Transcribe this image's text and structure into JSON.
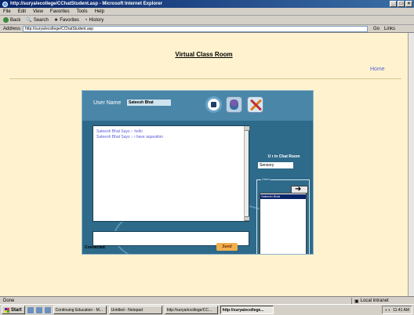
{
  "window": {
    "title": "http://surya/ecollege/CChatStudent.asp - Microsoft Internet Explorer",
    "controls": [
      "_",
      "□",
      "×"
    ]
  },
  "menu": [
    "File",
    "Edit",
    "View",
    "Favorites",
    "Tools",
    "Help"
  ],
  "toolbar": {
    "back": "Back",
    "search": "Search",
    "favorites": "Favorites",
    "history": "History"
  },
  "address": {
    "label": "Address",
    "url": "http://surya/ecollege/CChatStudent.asp",
    "go": "Go",
    "links": "Links"
  },
  "page": {
    "title": "Virtual Class Room",
    "home_link": "Home"
  },
  "chat": {
    "user_label": "User Name",
    "user_name": "Sateesh Bhat",
    "messages": [
      "Sateesh Bhat Says :- hello",
      "Sateesh Bhat Says :- i have aqueation"
    ],
    "room_title": "U r in Chat Room",
    "room_name": "Sensory",
    "users_label": "Users",
    "users": [
      "Sateesh Bhat"
    ],
    "status": "Connected",
    "send_label": "Send"
  },
  "status_bar": {
    "left": "Done",
    "zone": "Local intranet"
  },
  "taskbar": {
    "start": "Start",
    "tasks": [
      {
        "label": "Continuing Education - M...",
        "active": false
      },
      {
        "label": "Untitled - Notepad",
        "active": false
      },
      {
        "label": "http://surya/ecollege/CC...",
        "active": false
      },
      {
        "label": "http://surya/ecollege...",
        "active": true
      }
    ],
    "clock": "11:41 AM"
  }
}
